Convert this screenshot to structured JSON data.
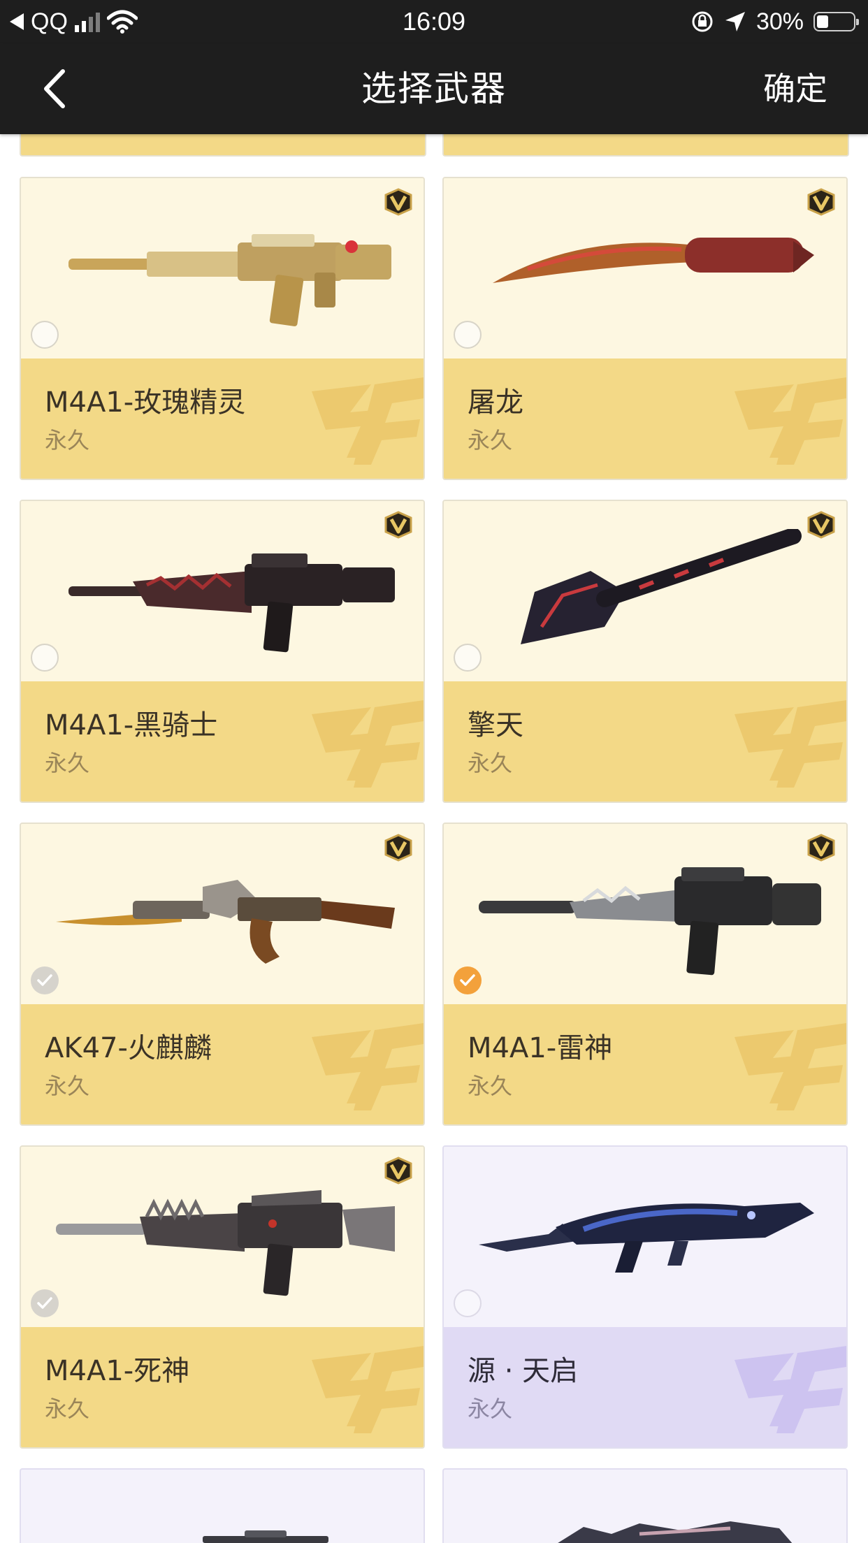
{
  "status_bar": {
    "carrier": "QQ",
    "time": "16:09",
    "battery_text": "30%",
    "battery_level": 0.3
  },
  "nav": {
    "title": "选择武器",
    "confirm_label": "确定"
  },
  "colors": {
    "gold_card_top": "#fdf7e1",
    "gold_card_bottom": "#f3d987",
    "purple_card_top": "#f4f2fb",
    "purple_card_bottom": "#e0daf4",
    "selected_check": "#f3a13b",
    "nav_bg": "#1e1e1e"
  },
  "weapons": [
    {
      "name": "M4A1-玫瑰精灵",
      "duration": "永久",
      "tier": "gold",
      "vip": true,
      "state": "unchecked"
    },
    {
      "name": "屠龙",
      "duration": "永久",
      "tier": "gold",
      "vip": true,
      "state": "unchecked"
    },
    {
      "name": "M4A1-黑骑士",
      "duration": "永久",
      "tier": "gold",
      "vip": true,
      "state": "unchecked"
    },
    {
      "name": "擎天",
      "duration": "永久",
      "tier": "gold",
      "vip": true,
      "state": "unchecked"
    },
    {
      "name": "AK47-火麒麟",
      "duration": "永久",
      "tier": "gold",
      "vip": true,
      "state": "disabled"
    },
    {
      "name": "M4A1-雷神",
      "duration": "永久",
      "tier": "gold",
      "vip": true,
      "state": "selected"
    },
    {
      "name": "M4A1-死神",
      "duration": "永久",
      "tier": "gold",
      "vip": true,
      "state": "disabled"
    },
    {
      "name": "源 · 天启",
      "duration": "永久",
      "tier": "purple",
      "vip": false,
      "state": "unchecked"
    }
  ]
}
